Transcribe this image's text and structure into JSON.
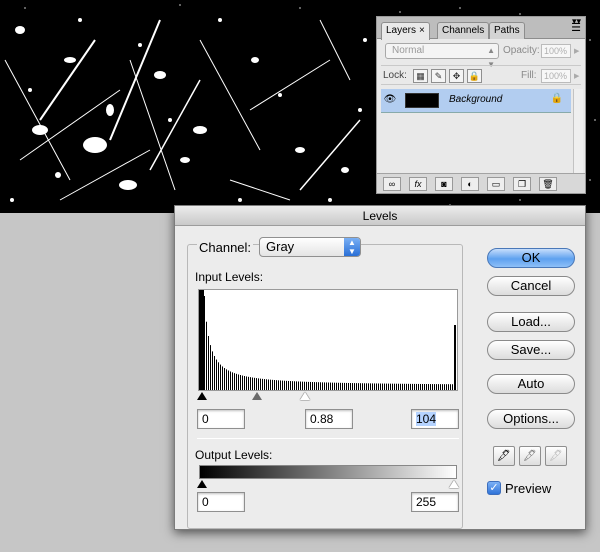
{
  "layers_panel": {
    "tabs": [
      "Layers",
      "Channels",
      "Paths"
    ],
    "close_glyph": "×",
    "blend_mode": "Normal",
    "opacity_label": "Opacity:",
    "opacity_value": "100%",
    "lock_label": "Lock:",
    "fill_label": "Fill:",
    "fill_value": "100%",
    "layer_name": "Background"
  },
  "levels": {
    "title": "Levels",
    "channel_label": "Channel:",
    "channel_value": "Gray",
    "input_label": "Input Levels:",
    "input_black": "0",
    "input_gamma": "0.88",
    "input_white": "104",
    "output_label": "Output Levels:",
    "output_black": "0",
    "output_white": "255",
    "buttons": {
      "ok": "OK",
      "cancel": "Cancel",
      "load": "Load...",
      "save": "Save...",
      "auto": "Auto",
      "options": "Options..."
    },
    "preview_label": "Preview",
    "preview_checked": true
  },
  "colors": {
    "accent": "#5ea1ef",
    "layer_selected": "#b2cdf0"
  }
}
